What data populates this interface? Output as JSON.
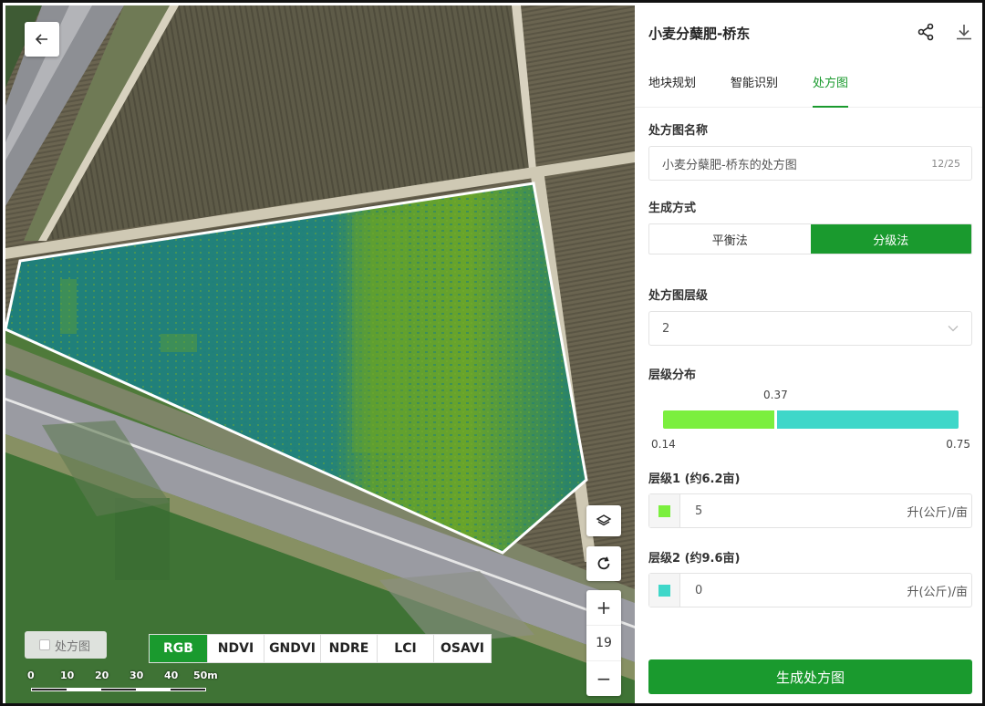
{
  "map": {
    "map_toggle_label": "处方图",
    "index_tabs": [
      "RGB",
      "NDVI",
      "GNDVI",
      "NDRE",
      "LCI",
      "OSAVI"
    ],
    "active_index": "RGB",
    "scale_labels": [
      "0",
      "10",
      "20",
      "30",
      "40",
      "50m"
    ],
    "zoom_level": "19",
    "zoom_in_label": "+",
    "zoom_out_label": "−",
    "icons": {
      "back": "arrow-left-icon",
      "layers": "layers-icon",
      "rotate": "refresh-icon"
    }
  },
  "panel": {
    "title": "小麦分蘖肥-桥东",
    "icons": {
      "share": "share-icon",
      "download": "download-icon"
    },
    "tabs": [
      "地块规划",
      "智能识别",
      "处方图"
    ],
    "active_tab": "处方图",
    "name_label": "处方图名称",
    "name_value": "小麦分蘖肥-桥东的处方图",
    "name_count": "12/25",
    "method_label": "生成方式",
    "methods": [
      "平衡法",
      "分级法"
    ],
    "active_method": "分级法",
    "levels_label": "处方图层级",
    "levels_value": "2",
    "dist_label": "层级分布",
    "dist_mid": "0.37",
    "dist_min": "0.14",
    "dist_max": "0.75",
    "dist_split_fraction": 0.377,
    "levels": [
      {
        "label": "层级1 (约6.2亩)",
        "value": "5",
        "unit": "升(公斤)/亩",
        "color": "#7bef3e"
      },
      {
        "label": "层级2 (约9.6亩)",
        "value": "0",
        "unit": "升(公斤)/亩",
        "color": "#3fd7c9"
      }
    ],
    "generate_label": "生成处方图"
  },
  "colors": {
    "accent": "#1a9a2e",
    "field_low": "#1f7f7a",
    "field_high": "#6aa527"
  }
}
